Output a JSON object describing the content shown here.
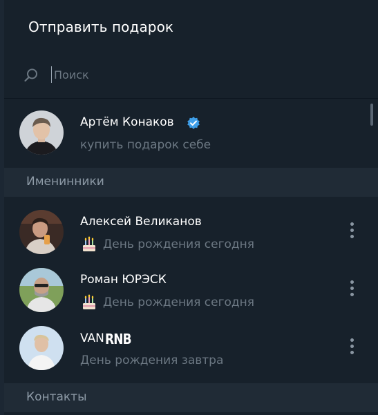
{
  "dialog": {
    "title": "Отправить подарок"
  },
  "search": {
    "placeholder": "Поиск",
    "icon": "search-icon"
  },
  "self_row": {
    "name": "Артём Конаков",
    "subtitle": "купить подарок себе",
    "verified": true
  },
  "sections": {
    "birthdays": "Именинники",
    "contacts": "Контакты"
  },
  "birthdays": [
    {
      "name": "Алексей Великанов",
      "subtitle": "День рождения сегодня",
      "icon": "birthday-cake-icon"
    },
    {
      "name": "Роман ЮРЭСК",
      "subtitle": "День рождения сегодня",
      "icon": "birthday-cake-icon"
    },
    {
      "name_prefix": "VAN",
      "name_suffix": "RNB",
      "subtitle": "День рождения завтра"
    }
  ],
  "colors": {
    "background": "#17212b",
    "section_background": "#202b36",
    "accent": "#3e9ee8",
    "muted_text": "#6c7883"
  }
}
